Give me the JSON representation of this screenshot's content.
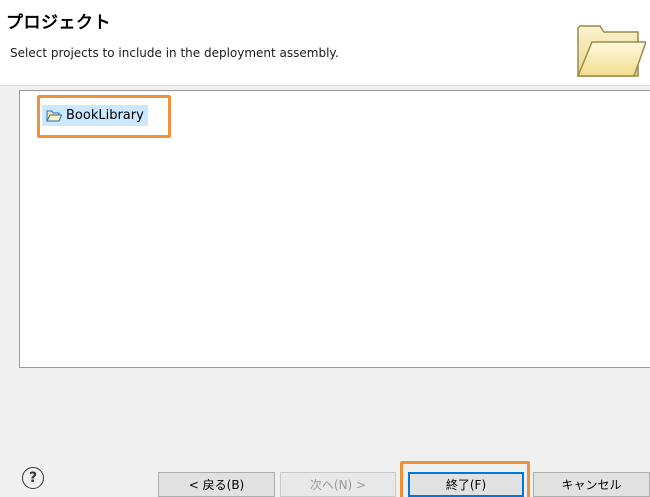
{
  "header": {
    "title": "プロジェクト",
    "description": "Select projects to include in the deployment assembly.",
    "icon": "folder-open-icon"
  },
  "project_list": {
    "items": [
      {
        "label": "BookLibrary",
        "icon": "folder-open-icon",
        "selected": true
      }
    ]
  },
  "buttons": {
    "help": "?",
    "back": "< 戻る(B)",
    "next": "次へ(N) >",
    "finish": "終了(F)",
    "cancel": "キャンセル"
  },
  "colors": {
    "highlight": "#f0913a",
    "selection": "#cce8ff",
    "default_button_border": "#0078d7"
  }
}
